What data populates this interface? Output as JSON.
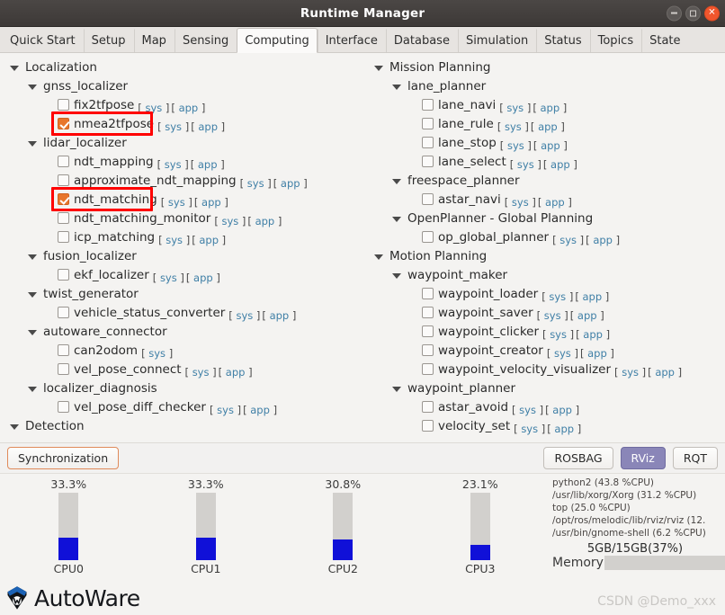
{
  "window": {
    "title": "Runtime Manager",
    "buttons": {
      "minimize": "minimize-icon",
      "maximize": "maximize-icon",
      "close": "close-icon"
    }
  },
  "tabs": [
    {
      "label": "Quick Start",
      "active": false
    },
    {
      "label": "Setup",
      "active": false
    },
    {
      "label": "Map",
      "active": false
    },
    {
      "label": "Sensing",
      "active": false
    },
    {
      "label": "Computing",
      "active": true
    },
    {
      "label": "Interface",
      "active": false
    },
    {
      "label": "Database",
      "active": false
    },
    {
      "label": "Simulation",
      "active": false
    },
    {
      "label": "Status",
      "active": false
    },
    {
      "label": "Topics",
      "active": false
    },
    {
      "label": "State",
      "active": false
    }
  ],
  "brackets": {
    "open": "[",
    "close": "]",
    "sys": "sys",
    "app": "app"
  },
  "left_pane": [
    {
      "type": "group",
      "level": 0,
      "label": "Localization"
    },
    {
      "type": "group",
      "level": 1,
      "label": "gnss_localizer"
    },
    {
      "type": "leaf",
      "level": 2,
      "label": "fix2tfpose",
      "checked": false,
      "links": [
        "sys",
        "app"
      ]
    },
    {
      "type": "leaf",
      "level": 2,
      "label": "nmea2tfpose",
      "checked": true,
      "links": [
        "sys",
        "app"
      ],
      "highlight": true
    },
    {
      "type": "group",
      "level": 1,
      "label": "lidar_localizer"
    },
    {
      "type": "leaf",
      "level": 2,
      "label": "ndt_mapping",
      "checked": false,
      "links": [
        "sys",
        "app"
      ]
    },
    {
      "type": "leaf",
      "level": 2,
      "label": "approximate_ndt_mapping",
      "checked": false,
      "links": [
        "sys",
        "app"
      ]
    },
    {
      "type": "leaf",
      "level": 2,
      "label": "ndt_matching",
      "checked": true,
      "links": [
        "sys",
        "app"
      ],
      "highlight": true
    },
    {
      "type": "leaf",
      "level": 2,
      "label": "ndt_matching_monitor",
      "checked": false,
      "links": [
        "sys",
        "app"
      ]
    },
    {
      "type": "leaf",
      "level": 2,
      "label": "icp_matching",
      "checked": false,
      "links": [
        "sys",
        "app"
      ]
    },
    {
      "type": "group",
      "level": 1,
      "label": "fusion_localizer"
    },
    {
      "type": "leaf",
      "level": 2,
      "label": "ekf_localizer",
      "checked": false,
      "links": [
        "sys",
        "app"
      ]
    },
    {
      "type": "group",
      "level": 1,
      "label": "twist_generator"
    },
    {
      "type": "leaf",
      "level": 2,
      "label": "vehicle_status_converter",
      "checked": false,
      "links": [
        "sys",
        "app"
      ]
    },
    {
      "type": "group",
      "level": 1,
      "label": "autoware_connector"
    },
    {
      "type": "leaf",
      "level": 2,
      "label": "can2odom",
      "checked": false,
      "links": [
        "sys"
      ]
    },
    {
      "type": "leaf",
      "level": 2,
      "label": "vel_pose_connect",
      "checked": false,
      "links": [
        "sys",
        "app"
      ]
    },
    {
      "type": "group",
      "level": 1,
      "label": "localizer_diagnosis"
    },
    {
      "type": "leaf",
      "level": 2,
      "label": "vel_pose_diff_checker",
      "checked": false,
      "links": [
        "sys",
        "app"
      ]
    },
    {
      "type": "group",
      "level": 0,
      "label": "Detection"
    }
  ],
  "right_pane": [
    {
      "type": "group",
      "level": 0,
      "label": "Mission Planning"
    },
    {
      "type": "group",
      "level": 1,
      "label": "lane_planner"
    },
    {
      "type": "leaf",
      "level": 2,
      "label": "lane_navi",
      "checked": false,
      "links": [
        "sys",
        "app"
      ]
    },
    {
      "type": "leaf",
      "level": 2,
      "label": "lane_rule",
      "checked": false,
      "links": [
        "sys",
        "app"
      ]
    },
    {
      "type": "leaf",
      "level": 2,
      "label": "lane_stop",
      "checked": false,
      "links": [
        "sys",
        "app"
      ]
    },
    {
      "type": "leaf",
      "level": 2,
      "label": "lane_select",
      "checked": false,
      "links": [
        "sys",
        "app"
      ]
    },
    {
      "type": "group",
      "level": 1,
      "label": "freespace_planner"
    },
    {
      "type": "leaf",
      "level": 2,
      "label": "astar_navi",
      "checked": false,
      "links": [
        "sys",
        "app"
      ]
    },
    {
      "type": "group",
      "level": 1,
      "label": "OpenPlanner - Global Planning"
    },
    {
      "type": "leaf",
      "level": 2,
      "label": "op_global_planner",
      "checked": false,
      "links": [
        "sys",
        "app"
      ]
    },
    {
      "type": "group",
      "level": 0,
      "label": "Motion Planning"
    },
    {
      "type": "group",
      "level": 1,
      "label": "waypoint_maker"
    },
    {
      "type": "leaf",
      "level": 2,
      "label": "waypoint_loader",
      "checked": false,
      "links": [
        "sys",
        "app"
      ]
    },
    {
      "type": "leaf",
      "level": 2,
      "label": "waypoint_saver",
      "checked": false,
      "links": [
        "sys",
        "app"
      ]
    },
    {
      "type": "leaf",
      "level": 2,
      "label": "waypoint_clicker",
      "checked": false,
      "links": [
        "sys",
        "app"
      ]
    },
    {
      "type": "leaf",
      "level": 2,
      "label": "waypoint_creator",
      "checked": false,
      "links": [
        "sys",
        "app"
      ]
    },
    {
      "type": "leaf",
      "level": 2,
      "label": "waypoint_velocity_visualizer",
      "checked": false,
      "links": [
        "sys",
        "app"
      ]
    },
    {
      "type": "group",
      "level": 1,
      "label": "waypoint_planner"
    },
    {
      "type": "leaf",
      "level": 2,
      "label": "astar_avoid",
      "checked": false,
      "links": [
        "sys",
        "app"
      ]
    },
    {
      "type": "leaf",
      "level": 2,
      "label": "velocity_set",
      "checked": false,
      "links": [
        "sys",
        "app"
      ]
    }
  ],
  "button_bar": {
    "sync_label": "Synchronization",
    "rosbag_label": "ROSBAG",
    "rviz_label": "RViz",
    "rqt_label": "RQT",
    "rviz_active": true
  },
  "monitor": {
    "cpus": [
      {
        "name": "CPU0",
        "percent": "33.3%",
        "value": 33.3
      },
      {
        "name": "CPU1",
        "percent": "33.3%",
        "value": 33.3
      },
      {
        "name": "CPU2",
        "percent": "30.8%",
        "value": 30.8
      },
      {
        "name": "CPU3",
        "percent": "23.1%",
        "value": 23.1
      }
    ],
    "processes": [
      "python2 (43.8 %CPU)",
      "/usr/lib/xorg/Xorg (31.2 %CPU)",
      "top (25.0 %CPU)",
      "/opt/ros/melodic/lib/rviz/rviz (12.",
      "/usr/bin/gnome-shell (6.2 %CPU)"
    ],
    "memory": {
      "text": "5GB/15GB(37%)",
      "label": "Memory",
      "percent": 37
    }
  },
  "footer": {
    "logo_text": "AutoWare",
    "watermark": "CSDN @Demo_xxx"
  },
  "colors": {
    "accent_orange": "#e8762c",
    "link_blue": "#3f7fa6",
    "highlight_red": "#ff0000",
    "bar_blue": "#1010d8",
    "active_button": "#8a86b8"
  }
}
